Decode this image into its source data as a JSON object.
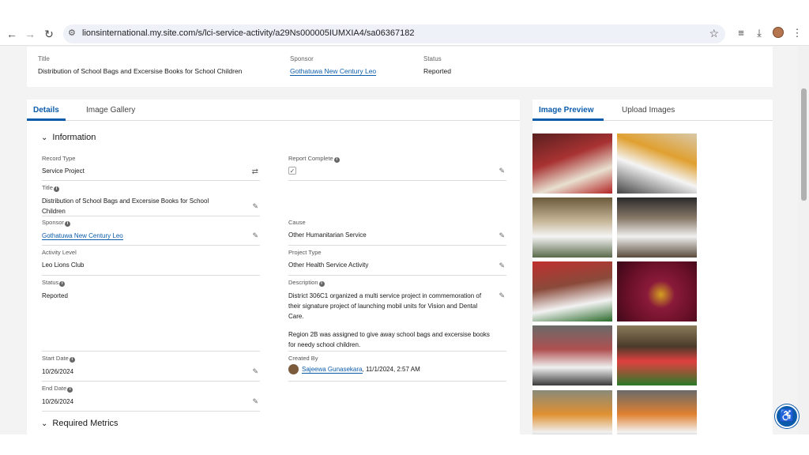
{
  "browser": {
    "url": "lionsinternational.my.site.com/s/lci-service-activity/a29Ns000005IUMXIA4/sa06367182"
  },
  "header": {
    "title_label": "Title",
    "title_value": "Distribution of School Bags and Excersise Books for School Children",
    "sponsor_label": "Sponsor",
    "sponsor_value": "Gothatuwa New Century Leo",
    "status_label": "Status",
    "status_value": "Reported"
  },
  "details_tabs": [
    "Details",
    "Image Gallery"
  ],
  "sections": {
    "information": "Information",
    "required_metrics": "Required Metrics"
  },
  "fields": {
    "record_type": {
      "label": "Record Type",
      "value": "Service Project"
    },
    "report_complete": {
      "label": "Report Complete",
      "value": "✓"
    },
    "title": {
      "label": "Title",
      "value": "Distribution of School Bags and Excersise Books for School Children"
    },
    "sponsor": {
      "label": "Sponsor",
      "value": "Gothatuwa New Century Leo"
    },
    "cause": {
      "label": "Cause",
      "value": "Other Humanitarian Service"
    },
    "activity_level": {
      "label": "Activity Level",
      "value": "Leo Lions Club"
    },
    "project_type": {
      "label": "Project Type",
      "value": "Other Health Service Activity"
    },
    "status": {
      "label": "Status",
      "value": "Reported"
    },
    "description": {
      "label": "Description",
      "paragraph1": "District 306C1 organized a multi service project in commemoration of their signature project of launching mobil units for Vision and Dental Care.",
      "paragraph2": "Region 2B was assigned to give away school bags and excersise books for needy school children."
    },
    "start_date": {
      "label": "Start Date",
      "value": "10/26/2024"
    },
    "created_by": {
      "label": "Created By",
      "name": "Sajeewa Gunasekara",
      "datetime": ", 11/1/2024, 2:57 AM"
    },
    "end_date": {
      "label": "End Date",
      "value": "10/26/2024"
    }
  },
  "image_tabs": [
    "Image Preview",
    "Upload Images"
  ],
  "colors": {
    "accent": "#0b5cab",
    "background": "#f3f3f3"
  }
}
